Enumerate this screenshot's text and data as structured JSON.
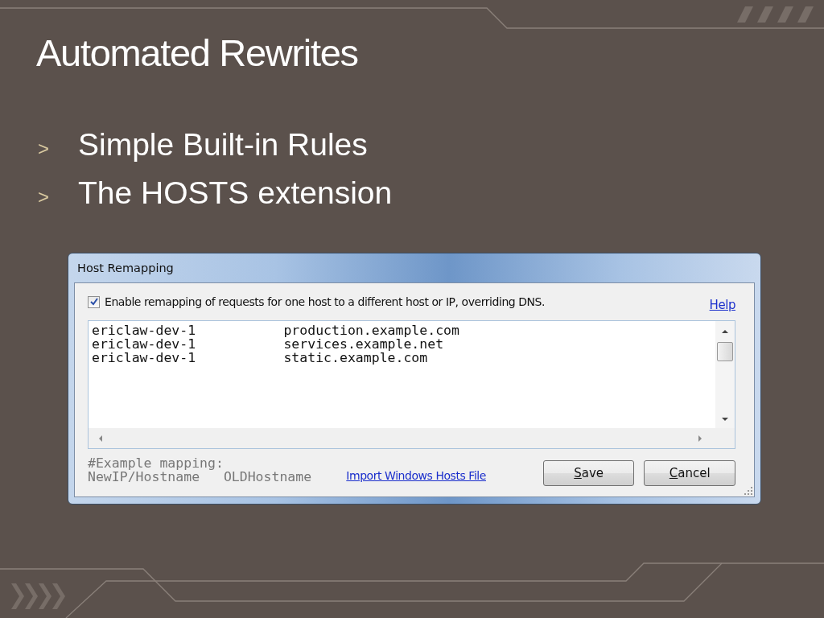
{
  "slide": {
    "title": "Automated Rewrites",
    "bullets": [
      {
        "marker": ">",
        "text": "Simple Built-in Rules"
      },
      {
        "marker": ">",
        "text": "The HOSTS extension"
      }
    ]
  },
  "dialog": {
    "title": "Host Remapping",
    "enable_checkbox": {
      "label": "Enable remapping of requests for one host to a different host or IP, overriding DNS.",
      "checked": true
    },
    "help_link": "Help",
    "mappings": [
      "ericlaw-dev-1\tproduction.example.com",
      "ericlaw-dev-1\tservices.example.net",
      "ericlaw-dev-1\tstatic.example.com"
    ],
    "hint_lines": [
      "#Example mapping:",
      "NewIP/Hostname   OLDHostname"
    ],
    "import_link": "Import Windows Hosts File",
    "buttons": [
      "Save",
      "Cancel"
    ]
  }
}
